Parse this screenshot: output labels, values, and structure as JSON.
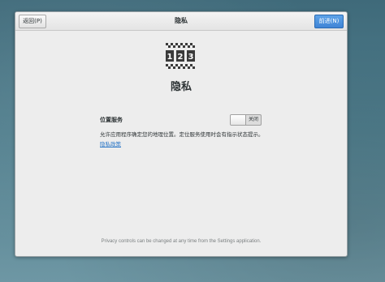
{
  "header": {
    "back_label": "返回(P)",
    "title": "隐私",
    "next_label": "前进(N)"
  },
  "page": {
    "heading": "隐私",
    "logo_digits": [
      "1",
      "2",
      "3"
    ]
  },
  "location_services": {
    "label": "位置服务",
    "toggle_state_label": "关闭",
    "description": "允许应用程序确定您的地理位置。定位服务使用时会有指示状态提示。",
    "policy_link": "隐私政策"
  },
  "footer": {
    "note": "Privacy controls can be changed at any time from the Settings application."
  },
  "colors": {
    "accent": "#3f84d6",
    "link": "#2a76c6",
    "window_bg": "#ededed"
  }
}
